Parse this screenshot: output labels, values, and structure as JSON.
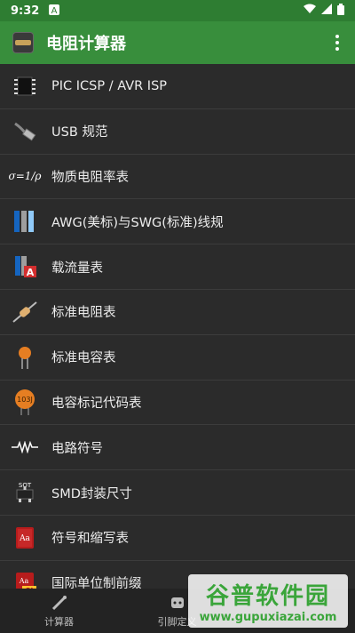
{
  "status_bar": {
    "time": "9:32",
    "notif_letter": "A"
  },
  "app_bar": {
    "title": "电阻计算器"
  },
  "list": {
    "items": [
      {
        "label": "PIC ICSP / AVR ISP",
        "icon": "chip-icon"
      },
      {
        "label": "USB 规范",
        "icon": "usb-cable-icon"
      },
      {
        "label": "物质电阻率表",
        "icon": "resistivity-formula-icon"
      },
      {
        "label": "AWG(美标)与SWG(标准)线规",
        "icon": "wire-gauge-icon"
      },
      {
        "label": "载流量表",
        "icon": "ampacity-icon"
      },
      {
        "label": "标准电阻表",
        "icon": "resistor-icon"
      },
      {
        "label": "标准电容表",
        "icon": "ceramic-capacitor-icon"
      },
      {
        "label": "电容标记代码表",
        "icon": "capacitor-code-icon"
      },
      {
        "label": "电路符号",
        "icon": "circuit-symbol-icon"
      },
      {
        "label": "SMD封装尺寸",
        "icon": "smd-package-icon"
      },
      {
        "label": "符号和缩写表",
        "icon": "book-icon"
      },
      {
        "label": "国际单位制前缀",
        "icon": "si-book-icon"
      }
    ]
  },
  "icon_text": {
    "formula": "σ=1/ρ",
    "capacitor_code": "103J",
    "smd": "SOT",
    "book": "Aa",
    "si": "SI"
  },
  "bottom_nav": {
    "items": [
      {
        "label": "计算器"
      },
      {
        "label": "引脚定义"
      },
      {
        "label": ""
      }
    ]
  },
  "watermark": {
    "title": "谷普软件园",
    "url": "www.gupuxiazai.com"
  },
  "colors": {
    "status_bar": "#2e7d32",
    "app_bar": "#388e3c",
    "background": "#2b2b2b"
  }
}
